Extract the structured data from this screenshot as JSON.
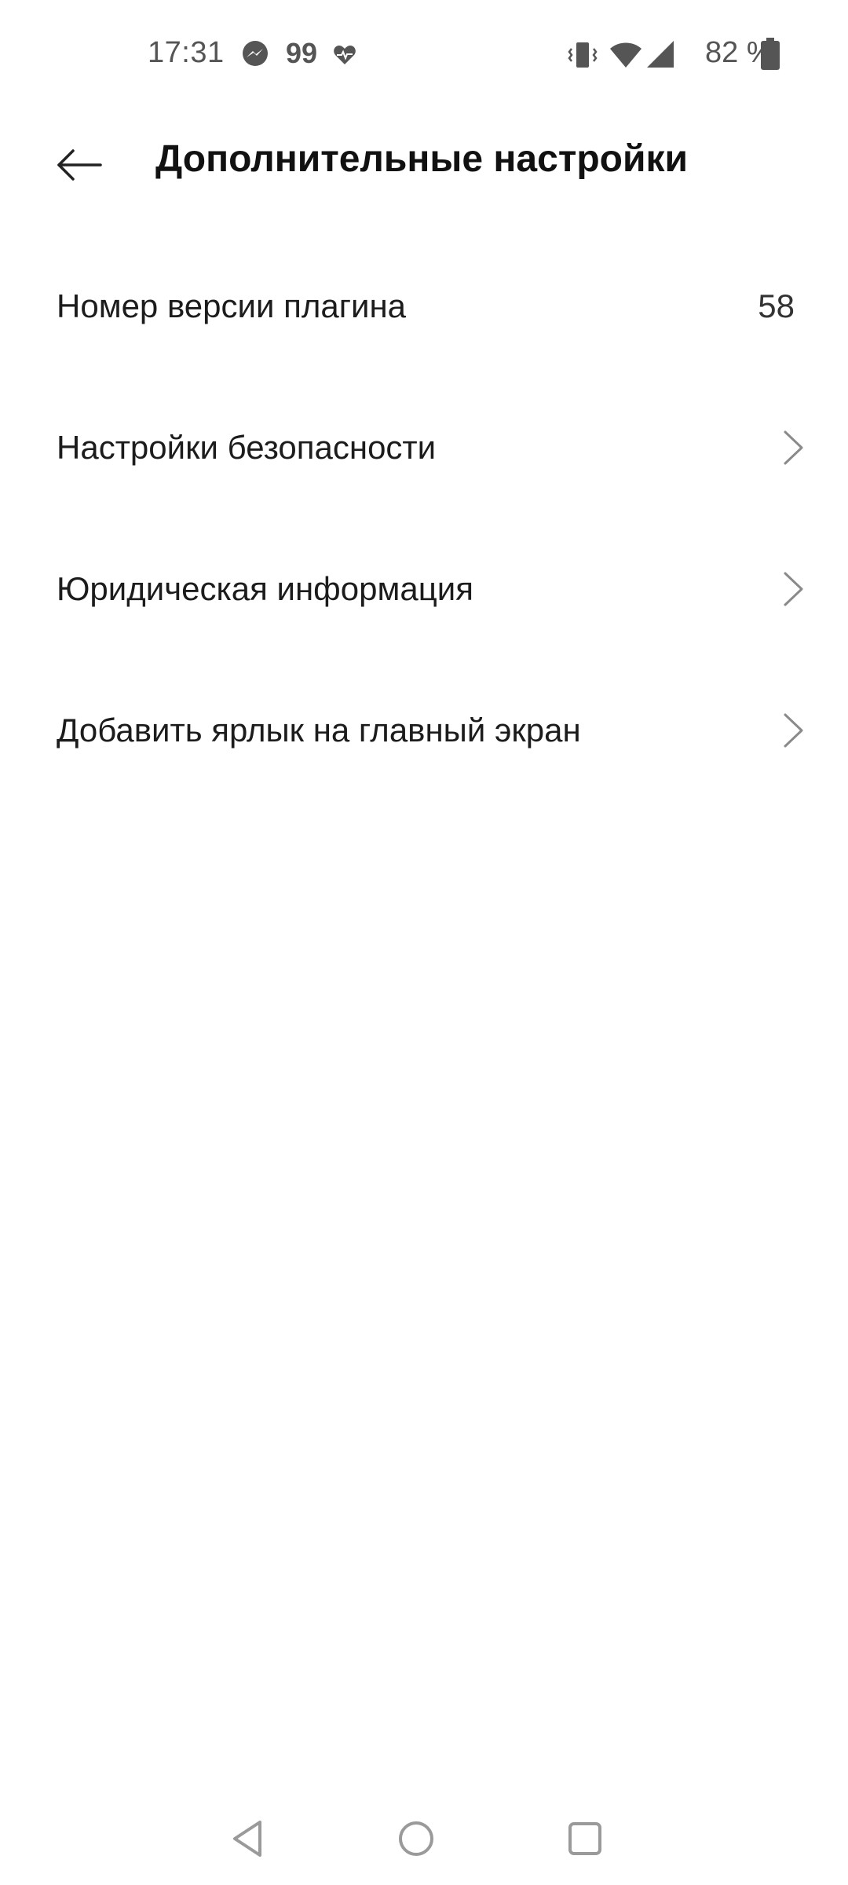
{
  "status_bar": {
    "time": "17:31",
    "notification_count": "99",
    "battery_percent": "82 %",
    "icons": [
      "messenger-icon",
      "heart-icon",
      "vibrate-icon",
      "wifi-icon",
      "signal-icon",
      "battery-icon"
    ]
  },
  "header": {
    "back_icon": "arrow-left-icon",
    "title": "Дополнительные настройки"
  },
  "settings": {
    "items": [
      {
        "label": "Номер версии плагина",
        "value": "58"
      },
      {
        "label": "Настройки безопасности",
        "icon": "chevron-right-icon"
      },
      {
        "label": "Юридическая информация",
        "icon": "chevron-right-icon"
      },
      {
        "label": "Добавить ярлык на главный экран",
        "icon": "chevron-right-icon"
      }
    ]
  },
  "nav_bar": {
    "icons": [
      "back-triangle-icon",
      "home-circle-icon",
      "recents-square-icon"
    ]
  },
  "colors": {
    "background": "#ffffff",
    "text_primary": "#1c1c1c",
    "status_gray": "#555555",
    "chevron": "#8a8a8a",
    "nav_icon": "#9a9a9a"
  }
}
